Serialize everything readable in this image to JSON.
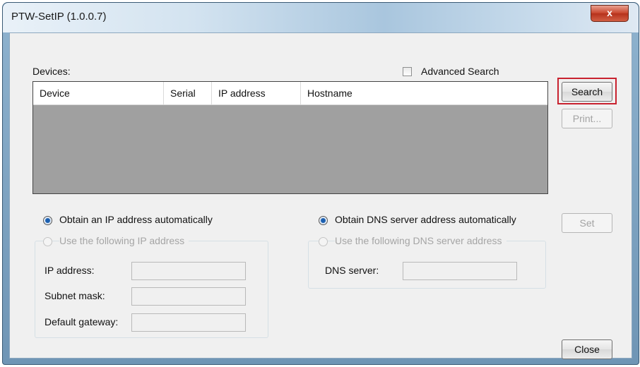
{
  "window": {
    "title": "PTW-SetIP (1.0.0.7)",
    "close_glyph": "x"
  },
  "devices": {
    "label": "Devices:",
    "advanced_search": "Advanced Search",
    "columns": [
      "Device",
      "Serial",
      "IP address",
      "Hostname"
    ]
  },
  "buttons": {
    "search": "Search",
    "print": "Print...",
    "set": "Set",
    "close": "Close"
  },
  "ip": {
    "auto": "Obtain an IP address automatically",
    "manual": "Use the following IP address",
    "ip_label": "IP address:",
    "subnet_label": "Subnet mask:",
    "gateway_label": "Default gateway:"
  },
  "dns": {
    "auto": "Obtain DNS server address automatically",
    "manual": "Use the following DNS server address",
    "server_label": "DNS server:"
  }
}
